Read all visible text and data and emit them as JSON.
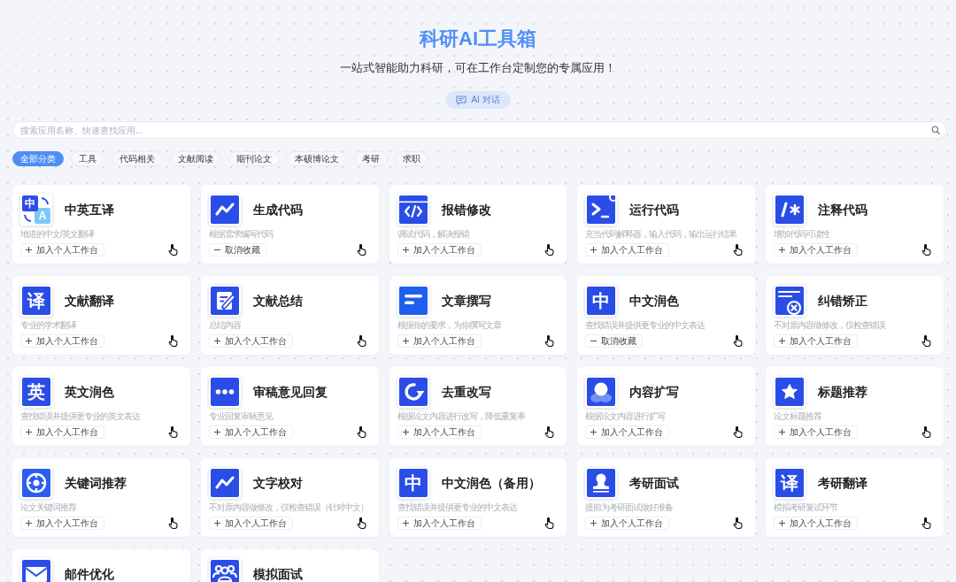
{
  "header": {
    "title": "科研AI工具箱",
    "subtitle": "一站式智能助力科研，可在工作台定制您的专属应用！",
    "chat_button": "AI 对话"
  },
  "search": {
    "placeholder": "搜索应用名称、快速查找应用..."
  },
  "categories": [
    {
      "label": "全部分类",
      "selected": true
    },
    {
      "label": "工具",
      "selected": false
    },
    {
      "label": "代码相关",
      "selected": false
    },
    {
      "label": "文献阅读",
      "selected": false
    },
    {
      "label": "期刊论文",
      "selected": false
    },
    {
      "label": "本硕博论文",
      "selected": false
    },
    {
      "label": "考研",
      "selected": false
    },
    {
      "label": "求职",
      "selected": false
    }
  ],
  "apps": [
    {
      "kind": "bilingual",
      "glyphs": [
        "中",
        "A"
      ],
      "title": "中英互译",
      "description": "地道的中文/英文翻译",
      "action": "加入个人工作台",
      "favorited": false
    },
    {
      "kind": "trend",
      "title": "生成代码",
      "description": "根据需求编写代码",
      "action": "取消收藏",
      "favorited": true
    },
    {
      "kind": "code",
      "title": "报错修改",
      "description": "调试代码，解决报错",
      "action": "加入个人工作台",
      "favorited": false
    },
    {
      "kind": "terminal",
      "title": "运行代码",
      "description": "充当代码解释器，输入代码，输出运行结果",
      "action": "加入个人工作台",
      "favorited": false
    },
    {
      "kind": "comment",
      "title": "注释代码",
      "description": "增加代码可读性",
      "action": "加入个人工作台",
      "favorited": false
    },
    {
      "kind": "glyph",
      "glyph": "译",
      "title": "文献翻译",
      "description": "专业的学术翻译",
      "action": "加入个人工作台",
      "favorited": false
    },
    {
      "kind": "edit",
      "title": "文献总结",
      "description": "总结内容",
      "action": "加入个人工作台",
      "favorited": false
    },
    {
      "kind": "lines",
      "title": "文章撰写",
      "description": "根据你的要求，为你撰写文章",
      "action": "加入个人工作台",
      "favorited": false
    },
    {
      "kind": "glyph",
      "glyph": "中",
      "title": "中文润色",
      "description": "查找错误并提供更专业的中文表达",
      "action": "取消收藏",
      "favorited": true
    },
    {
      "kind": "error",
      "title": "纠错矫正",
      "description": "不对原内容做修改，仅检查错误",
      "action": "加入个人工作台",
      "favorited": false
    },
    {
      "kind": "glyph",
      "glyph": "英",
      "title": "英文润色",
      "description": "查找错误并提供更专业的英文表达",
      "action": "加入个人工作台",
      "favorited": false
    },
    {
      "kind": "dots",
      "title": "审稿意见回复",
      "description": "专业回复审稿意见",
      "action": "加入个人工作台",
      "favorited": false
    },
    {
      "kind": "refresh",
      "title": "去重改写",
      "description": "根据论文内容进行改写，降低重复率",
      "action": "加入个人工作台",
      "favorited": false
    },
    {
      "kind": "user",
      "title": "内容扩写",
      "description": "根据论文内容进行扩写",
      "action": "加入个人工作台",
      "favorited": false
    },
    {
      "kind": "star",
      "title": "标题推荐",
      "description": "论文标题推荐",
      "action": "加入个人工作台",
      "favorited": false
    },
    {
      "kind": "target",
      "title": "关键词推荐",
      "description": "论文关键词推荐",
      "action": "加入个人工作台",
      "favorited": false
    },
    {
      "kind": "trend",
      "title": "文字校对",
      "description": "不对原内容做修改，仅检查错误（针对中文）",
      "action": "加入个人工作台",
      "favorited": false
    },
    {
      "kind": "glyph",
      "glyph": "中",
      "title": "中文润色（备用）",
      "description": "查找错误并提供更专业的中文表达",
      "action": "加入个人工作台",
      "favorited": false
    },
    {
      "kind": "stamp",
      "title": "考研面试",
      "description": "提前为考研面试做好准备",
      "action": "加入个人工作台",
      "favorited": false
    },
    {
      "kind": "glyph",
      "glyph": "译",
      "title": "考研翻译",
      "description": "模拟考研复试环节",
      "action": "加入个人工作台",
      "favorited": false
    },
    {
      "kind": "mail",
      "title": "邮件优化"
    },
    {
      "kind": "group",
      "title": "模拟面试"
    }
  ]
}
